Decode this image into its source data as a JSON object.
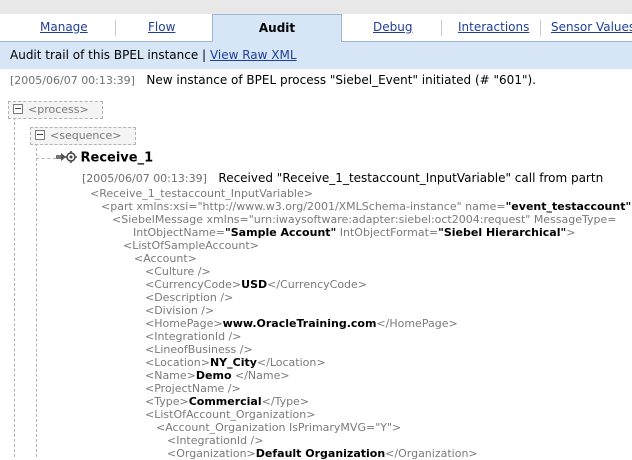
{
  "tabs": [
    {
      "label": "Manage"
    },
    {
      "label": "Flow"
    },
    {
      "label": "Audit"
    },
    {
      "label": "Debug"
    },
    {
      "label": "Interactions"
    },
    {
      "label": "Sensor Values"
    }
  ],
  "subheader": {
    "text": "Audit trail of this BPEL instance |",
    "link": "View Raw XML"
  },
  "entry1": {
    "timestamp": "[2005/06/07 00:13:39]",
    "message": "New instance of BPEL process \"Siebel_Event\" initiated (# \"601\")."
  },
  "tree": {
    "process": "<process>",
    "sequence": "<sequence>"
  },
  "activity": {
    "name": "Receive_1",
    "timestamp": "[2005/06/07 00:13:39]",
    "message": "Received \"Receive_1_testaccount_InputVariable\" call from partn"
  },
  "xml": {
    "l1": "<Receive_1_testaccount_InputVariable>",
    "l2": "<part xmlns:xsi=\"http://www.w3.org/2001/XMLSchema-instance\" name=",
    "l2b": "\"event_testaccount\"",
    "l3": "<SiebelMessage xmlns=\"urn:iwaysoftware:adapter:siebel:oct2004:request\" MessageType=",
    "l4a": "IntObjectName=",
    "l4b": "\"Sample Account\"",
    "l4c": " IntObjectFormat=",
    "l4d": "\"Siebel Hierarchical\"",
    "l4e": ">",
    "l5": "<ListOfSampleAccount>",
    "l6": "<Account>",
    "l7": "<Culture />",
    "l8a": "<CurrencyCode>",
    "l8b": "USD",
    "l8c": "</CurrencyCode>",
    "l9": "<Description />",
    "l10": "<Division />",
    "l11a": "<HomePage>",
    "l11b": "www.OracleTraining.com",
    "l11c": "</HomePage>",
    "l12": "<IntegrationId />",
    "l13": "<LineofBusiness />",
    "l14a": "<Location>",
    "l14b": "NY_City",
    "l14c": "</Location>",
    "l15a": "<Name>",
    "l15b": "Demo",
    "l15c": " </Name>",
    "l16": "<ProjectName />",
    "l17a": "<Type>",
    "l17b": "Commercial",
    "l17c": "</Type>",
    "l18": "<ListOfAccount_Organization>",
    "l19": "<Account_Organization IsPrimaryMVG=\"Y\">",
    "l20": "<IntegrationId />",
    "l21a": "<Organization>",
    "l21b": "Default Organization",
    "l21c": "</Organization>"
  }
}
